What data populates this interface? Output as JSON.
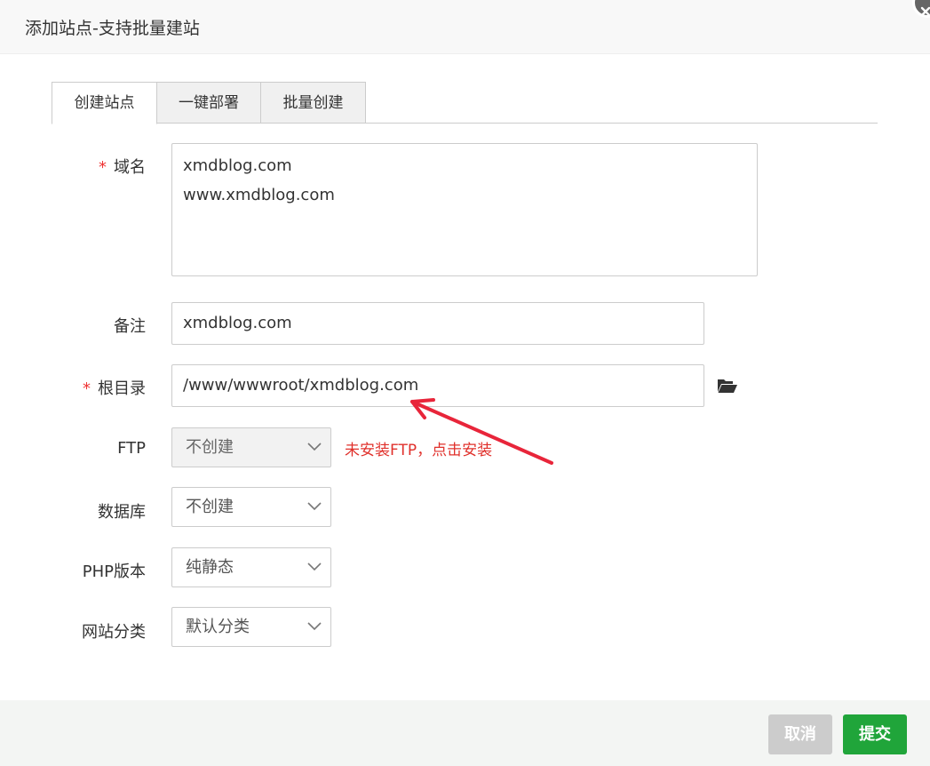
{
  "dialog": {
    "title": "添加站点-支持批量建站"
  },
  "tabs": [
    {
      "label": "创建站点",
      "active": true
    },
    {
      "label": "一键部署",
      "active": false
    },
    {
      "label": "批量创建",
      "active": false
    }
  ],
  "form": {
    "domain": {
      "required_mark": "*",
      "label": "域名",
      "lines": [
        "xmdblog.com",
        "www.xmdblog.com"
      ]
    },
    "remark": {
      "label": "备注",
      "value": "xmdblog.com"
    },
    "root_dir": {
      "required_mark": "*",
      "label": "根目录",
      "value": "/www/wwwroot/xmdblog.com"
    },
    "ftp": {
      "label": "FTP",
      "value": "不创建",
      "hint": "未安装FTP，点击安装"
    },
    "database": {
      "label": "数据库",
      "value": "不创建"
    },
    "php_version": {
      "label": "PHP版本",
      "value": "纯静态"
    },
    "site_category": {
      "label": "网站分类",
      "value": "默认分类"
    }
  },
  "footer": {
    "cancel_label": "取消",
    "submit_label": "提交"
  },
  "colors": {
    "accent_green": "#20a53a",
    "required_red": "#e33333",
    "hint_red": "#e0302b",
    "annotation_arrow": "#e8253a"
  },
  "icons": {
    "close": "close-icon",
    "folder": "folder-open-icon",
    "chevron": "chevron-down-icon"
  }
}
